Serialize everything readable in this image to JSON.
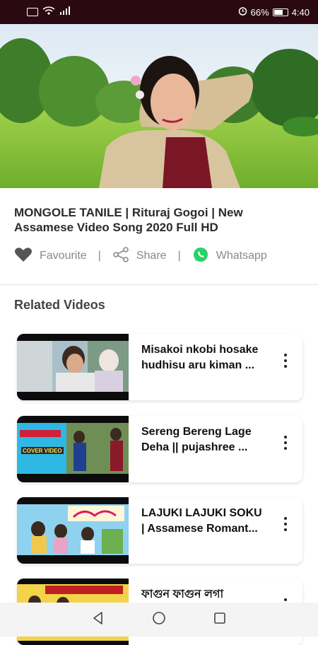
{
  "status_bar": {
    "battery": "66%",
    "time": "4:40"
  },
  "video": {
    "title_line1": "MONGOLE TANILE | Rituraj Gogoi | New",
    "title_line2": "Assamese Video Song 2020 Full HD"
  },
  "actions": {
    "favourite": "Favourite",
    "share": "Share",
    "whatsapp": "Whatsapp",
    "separator": "|"
  },
  "related": {
    "heading": "Related Videos",
    "items": [
      {
        "line1": "Misakoi nkobi hosake",
        "line2": "hudhisu aru kiman ..."
      },
      {
        "line1": "Sereng Bereng Lage",
        "line2": "Deha || pujashree ...",
        "thumb_badge": "COVER VIDEO"
      },
      {
        "line1": "LAJUKI LAJUKI SOKU",
        "line2": "| Assamese Romant..."
      },
      {
        "line1": "ফাগুন ফাগুন লগা",
        "line2": ""
      }
    ]
  },
  "colors": {
    "status_bg": "#2a0a10",
    "whatsapp_green": "#25d366",
    "text_gray": "#8a8a8a"
  }
}
